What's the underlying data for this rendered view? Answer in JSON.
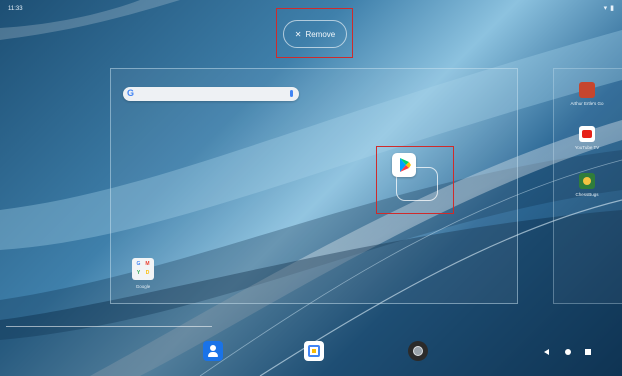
{
  "status_bar": {
    "time": "11:33",
    "icons": [
      "wifi-icon",
      "battery-icon"
    ]
  },
  "remove_action": {
    "icon": "close-icon",
    "label": "Remove"
  },
  "search_widget": {
    "logo": "G",
    "icon": "mic-icon"
  },
  "dragged_app": {
    "icon": "play-store-icon"
  },
  "home_folder": {
    "label": "Google",
    "letters": [
      "G",
      "M",
      "Y",
      "D"
    ]
  },
  "side_page_apps": [
    {
      "icon": "game-icon",
      "label": "Arthur Ertle's Go"
    },
    {
      "icon": "youtube-tv-icon",
      "label": "YouTube TV"
    },
    {
      "icon": "chessbuqs-icon",
      "label": "ChessBugs"
    }
  ],
  "dock": [
    {
      "icon": "contacts-icon"
    },
    {
      "icon": "calendar-icon"
    },
    {
      "icon": "camera-icon"
    }
  ],
  "nav_bar": [
    "back-icon",
    "home-icon",
    "recents-icon"
  ],
  "colors": {
    "highlight": "#cf2b2b",
    "accent": "#4285f4",
    "wallpaper": "#2e6a97"
  }
}
